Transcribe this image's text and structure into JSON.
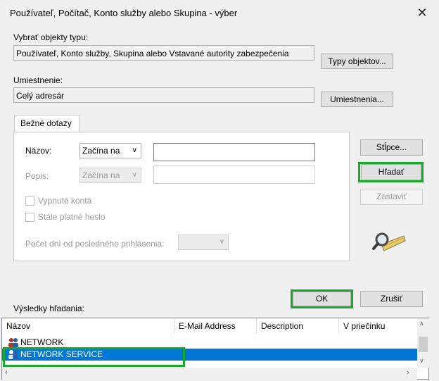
{
  "window": {
    "title": "Používateľ, Počítač, Konto služby alebo Skupina - výber",
    "close_icon": "✕"
  },
  "object_types": {
    "label": "Vybrať objekty typu:",
    "value": "Používateľ, Konto služby, Skupina alebo Vstavané autority zabezpečenia",
    "button": "Typy objektov..."
  },
  "location": {
    "label": "Umiestnenie:",
    "value": "Celý adresár",
    "button": "Umiestnenia..."
  },
  "tab": {
    "label": "Bežné dotazy"
  },
  "query": {
    "name_label": "Názov:",
    "name_mode": "Začína na",
    "description_label": "Popis:",
    "description_mode": "Začína na",
    "disabled_accounts": "Vypnuté kontá",
    "non_expiring_password": "Stále platné heslo",
    "days_since_login_label": "Počet dní od posledného prihlásenia:"
  },
  "side_buttons": {
    "columns": "Stĺpce...",
    "find": "Hľadať",
    "stop": "Zastaviť"
  },
  "dialog_buttons": {
    "ok": "OK",
    "cancel": "Zrušiť"
  },
  "results": {
    "label": "Výsledky hľadania:",
    "columns": [
      "Názov",
      "E-Mail Address",
      "Description",
      "V priečinku"
    ],
    "rows": [
      {
        "name": "NETWORK",
        "selected": false
      },
      {
        "name": "NETWORK SERVICE",
        "selected": true
      }
    ]
  },
  "colors": {
    "highlight": "#1aaa2a",
    "selection": "#0078d7"
  }
}
